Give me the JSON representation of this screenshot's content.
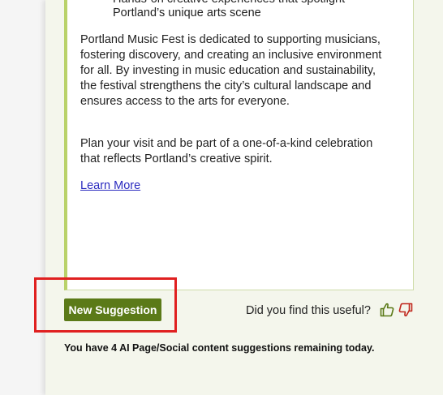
{
  "content": {
    "bullet_line_1": "Hands-on creative experiences that spotlight",
    "bullet_line_2": "Portland’s unique arts scene",
    "paragraph_1": "Portland Music Fest is dedicated to supporting musicians, fostering discovery, and creating an inclusive environment for all. By investing in music education and sustainability, the festival strengthens the city’s cultural landscape and ensures access to the arts for everyone.",
    "paragraph_2": "Plan your visit and be part of a one-of-a-kind celebration that reflects Portland’s creative spirit.",
    "learn_more_link": "Learn More"
  },
  "actions": {
    "new_suggestion_label": "New Suggestion",
    "feedback_question": "Did you find this useful?",
    "thumbs_up_icon": "thumbs-up-icon",
    "thumbs_down_icon": "thumbs-down-icon"
  },
  "status": {
    "remaining_text": "You have 4 AI Page/Social content suggestions remaining today."
  },
  "colors": {
    "accent_green": "#5b7a18",
    "card_border": "#b9d26a",
    "link": "#2a2abf",
    "highlight": "#e02020",
    "thumb_up": "#5b7a18",
    "thumb_down": "#c0281e"
  }
}
